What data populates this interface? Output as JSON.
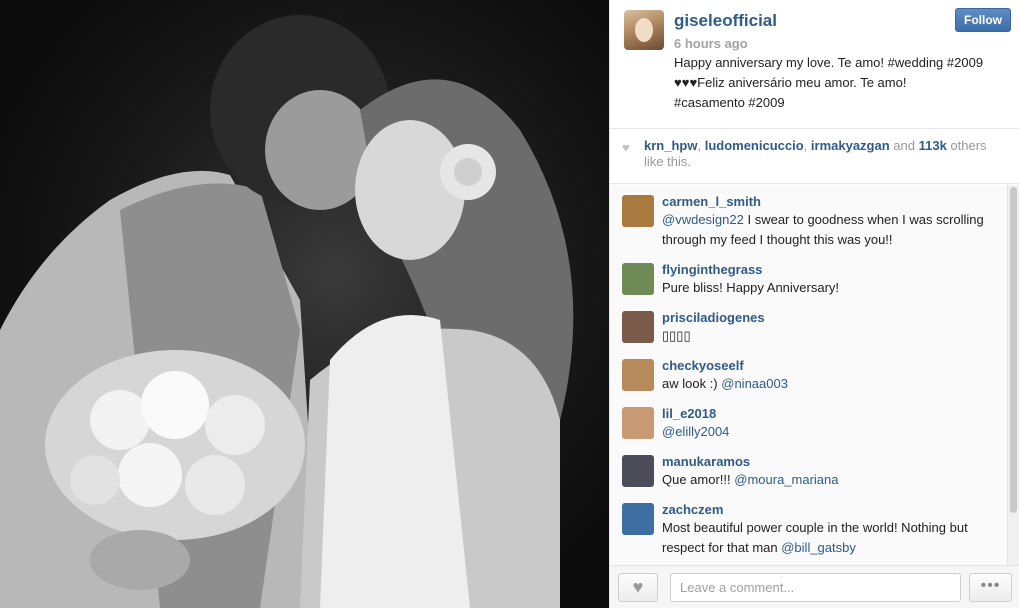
{
  "post": {
    "username": "giseleofficial",
    "time_ago": "6 hours ago",
    "follow_label": "Follow",
    "caption_lines": [
      "Happy anniversary my love. Te amo! #wedding #2009",
      "♥♥♥Feliz aniversário meu amor. Te amo!",
      "#casamento #2009"
    ],
    "photo_alt": "black-and-white wedding photo"
  },
  "likes": {
    "users": [
      "krn_hpw",
      "ludomenicuccio",
      "irmakyazgan"
    ],
    "sep1": ", ",
    "sep2": ", ",
    "and_text": " and ",
    "count": "113k",
    "rest": " others like this."
  },
  "comments": [
    {
      "user": "carmen_l_smith",
      "mention": "@vwdesign22",
      "text": " I swear to goodness when I was scrolling through my feed I thought this was you!!",
      "avatar_color": "#a87a3f"
    },
    {
      "user": "flyinginthegrass",
      "mention": "",
      "text": "Pure bliss! Happy Anniversary!",
      "avatar_color": "#6f8a55"
    },
    {
      "user": "prisciladiogenes",
      "mention": "",
      "text": "▯▯▯▯",
      "avatar_color": "#7a5a48"
    },
    {
      "user": "checkyoseelf",
      "mention": "",
      "text": "aw look :) ",
      "mention_after": "@ninaa003",
      "avatar_color": "#b78a5c"
    },
    {
      "user": "lil_e2018",
      "mention": "@elilly2004",
      "text": "",
      "avatar_color": "#c79a74"
    },
    {
      "user": "manukaramos",
      "mention": "",
      "text": "Que amor!!! ",
      "mention_after": "@moura_mariana",
      "avatar_color": "#4d4d5a"
    },
    {
      "user": "zachczem",
      "mention": "",
      "text": "Most beautiful power couple in the world! Nothing but respect for that man ",
      "mention_after": "@bill_gatsby",
      "avatar_color": "#3d6fa3"
    }
  ],
  "footer": {
    "comment_placeholder": "Leave a comment...",
    "like_icon": "heart-icon",
    "more_icon": "ellipsis-icon",
    "more_label": "•••"
  }
}
